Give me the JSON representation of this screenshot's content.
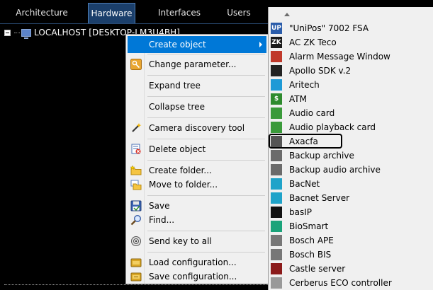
{
  "tabs": [
    {
      "label": "Architecture"
    },
    {
      "label": "Hardware"
    },
    {
      "label": "Interfaces"
    },
    {
      "label": "Users"
    }
  ],
  "active_tab": "Hardware",
  "tree": {
    "root_label": "LOCALHOST [DESKTOP-LM3U4BH]"
  },
  "context_menu": {
    "items": [
      {
        "label": "Create object",
        "icon": "none",
        "highlighted": true,
        "has_submenu": true
      },
      {
        "label": "Change parameter...",
        "icon": "key-icon"
      },
      {
        "label": "Expand tree",
        "icon": "none"
      },
      {
        "label": "Collapse tree",
        "icon": "none"
      },
      {
        "label": "Camera discovery tool",
        "icon": "wand-icon"
      },
      {
        "label": "Delete object",
        "icon": "delete-icon"
      },
      {
        "label": "Create folder...",
        "icon": "new-folder-icon"
      },
      {
        "label": "Move to folder...",
        "icon": "move-folder-icon"
      },
      {
        "label": "Save",
        "icon": "save-icon"
      },
      {
        "label": "Find...",
        "icon": "magnifier-icon"
      },
      {
        "label": "Send key to all",
        "icon": "broadcast-icon"
      },
      {
        "label": "Load configuration...",
        "icon": "load-config-icon"
      },
      {
        "label": "Save configuration...",
        "icon": "save-config-icon"
      }
    ]
  },
  "submenu": {
    "items": [
      {
        "label": "\"UniPos\" 7002 FSA",
        "icon": "unipos-icon",
        "icon_text": "UP",
        "icon_color": "#2a5caa"
      },
      {
        "label": "AC ZK Teco",
        "icon": "zk-icon",
        "icon_text": "ZK",
        "icon_color": "#1a1a1a"
      },
      {
        "label": "Alarm Message Window",
        "icon": "alarm-window-icon",
        "icon_text": "",
        "icon_color": "#c0392b"
      },
      {
        "label": "Apollo SDK v.2",
        "icon": "apollo-icon",
        "icon_text": "",
        "icon_color": "#222222"
      },
      {
        "label": "Aritech",
        "icon": "aritech-icon",
        "icon_text": "",
        "icon_color": "#1e9ad6"
      },
      {
        "label": "ATM",
        "icon": "atm-icon",
        "icon_text": "$",
        "icon_color": "#2e8b2e"
      },
      {
        "label": "Audio card",
        "icon": "audio-card-icon",
        "icon_text": "",
        "icon_color": "#3a9a3a"
      },
      {
        "label": "Audio playback card",
        "icon": "audio-playback-icon",
        "icon_text": "",
        "icon_color": "#3a9a3a"
      },
      {
        "label": "Axacfa",
        "icon": "axacfa-icon",
        "icon_text": "",
        "icon_color": "#555555",
        "outlined": true
      },
      {
        "label": "Backup archive",
        "icon": "backup-archive-icon",
        "icon_text": "",
        "icon_color": "#6b6b6b"
      },
      {
        "label": "Backup audio archive",
        "icon": "backup-audio-icon",
        "icon_text": "",
        "icon_color": "#6b6b6b"
      },
      {
        "label": "BacNet",
        "icon": "bacnet-icon",
        "icon_text": "",
        "icon_color": "#1fa3c9"
      },
      {
        "label": "Bacnet Server",
        "icon": "bacnet-server-icon",
        "icon_text": "",
        "icon_color": "#1fa3c9"
      },
      {
        "label": "basIP",
        "icon": "basip-icon",
        "icon_text": "",
        "icon_color": "#111111"
      },
      {
        "label": "BioSmart",
        "icon": "biosmart-icon",
        "icon_text": "",
        "icon_color": "#1aa37a"
      },
      {
        "label": "Bosch APE",
        "icon": "bosch-ape-icon",
        "icon_text": "",
        "icon_color": "#777777"
      },
      {
        "label": "Bosch BIS",
        "icon": "bosch-bis-icon",
        "icon_text": "",
        "icon_color": "#777777"
      },
      {
        "label": "Castle server",
        "icon": "castle-server-icon",
        "icon_text": "",
        "icon_color": "#8b1a1a"
      },
      {
        "label": "Cerberus ECO controller",
        "icon": "cerberus-icon",
        "icon_text": "",
        "icon_color": "#999999"
      }
    ]
  }
}
